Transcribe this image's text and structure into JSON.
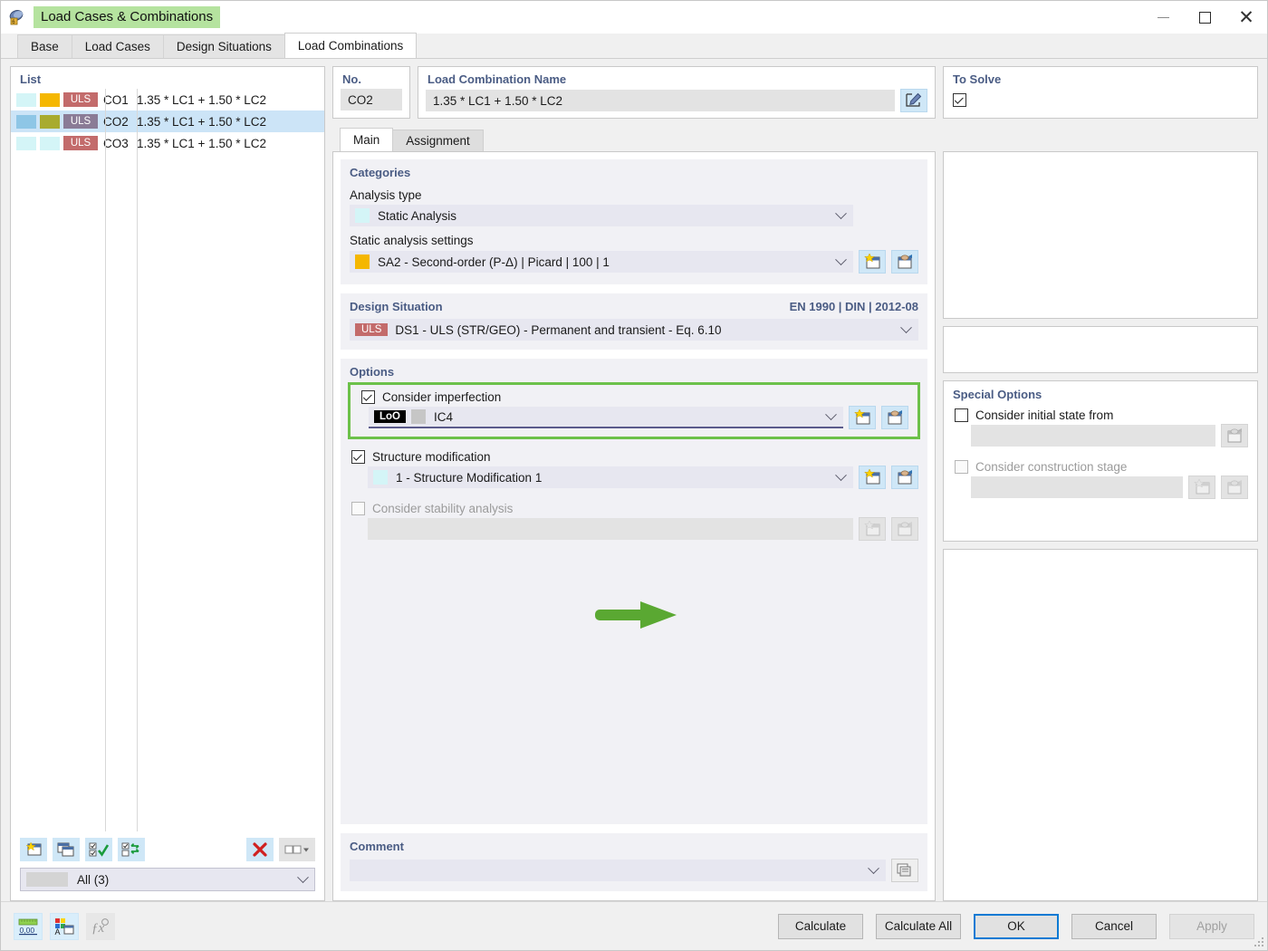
{
  "window": {
    "title": "Load Cases & Combinations",
    "icon": "load-cases-icon",
    "minimize_label": "—",
    "maximize_label": "□",
    "close_label": "✕"
  },
  "tabs": [
    {
      "label": "Base",
      "active": false
    },
    {
      "label": "Load Cases",
      "active": false
    },
    {
      "label": "Design Situations",
      "active": false
    },
    {
      "label": "Load Combinations",
      "active": true
    }
  ],
  "list_panel": {
    "title": "List",
    "rows": [
      {
        "sw1": "#d4f5f7",
        "sw2": "#f5b700",
        "badge": "ULS",
        "badge_bg": "#c36b6b",
        "id": "CO1",
        "expr": "1.35 * LC1 + 1.50 * LC2",
        "selected": false
      },
      {
        "sw1": "#8ec6e6",
        "sw2": "#a8ab2e",
        "badge": "ULS",
        "badge_bg": "#8a7b96",
        "id": "CO2",
        "expr": "1.35 * LC1 + 1.50 * LC2",
        "selected": true
      },
      {
        "sw1": "#d4f5f7",
        "sw2": "#d4f5f7",
        "badge": "ULS",
        "badge_bg": "#c36b6b",
        "id": "CO3",
        "expr": "1.35 * LC1 + 1.50 * LC2",
        "selected": false
      }
    ],
    "toolbar": {
      "new_label": "new-item",
      "copy_label": "copy-item",
      "select_all_label": "select-all",
      "invert_label": "invert-selection",
      "delete_label": "delete",
      "view_label": "view-options"
    },
    "filter": {
      "value": "All (3)"
    }
  },
  "no_box": {
    "title": "No.",
    "value": "CO2"
  },
  "name_box": {
    "title": "Load Combination Name",
    "value": "1.35 * LC1 + 1.50 * LC2",
    "edit_icon": "edit-pencil-icon"
  },
  "to_solve": {
    "title": "To Solve",
    "checked": true
  },
  "inner_tabs": [
    {
      "label": "Main",
      "active": true
    },
    {
      "label": "Assignment",
      "active": false
    }
  ],
  "categories": {
    "title": "Categories",
    "analysis_type": {
      "label": "Analysis type",
      "value": "Static Analysis",
      "swatch": "#d4f5f7"
    },
    "static_analysis_settings": {
      "label": "Static analysis settings",
      "value": "SA2 - Second-order (P-Δ) | Picard | 100 | 1",
      "swatch": "#f5b700",
      "new_icon": "new-item-icon",
      "edit_icon": "edit-item-icon"
    }
  },
  "design_situation": {
    "title": "Design Situation",
    "standard": "EN 1990 | DIN | 2012-08",
    "badge": "ULS",
    "value": "DS1 - ULS (STR/GEO) - Permanent and transient - Eq. 6.10"
  },
  "options": {
    "title": "Options",
    "consider_imperfection": {
      "label": "Consider imperfection",
      "checked": true,
      "highlighted": true,
      "badge": "LoO",
      "swatch": "#c6c6c6",
      "value": "IC4",
      "new_icon": "new-item-icon",
      "edit_icon": "edit-item-icon"
    },
    "structure_modification": {
      "label": "Structure modification",
      "checked": true,
      "swatch": "#d4f5f7",
      "value": "1 - Structure Modification 1",
      "new_icon": "new-item-icon",
      "edit_icon": "edit-item-icon"
    },
    "consider_stability_analysis": {
      "label": "Consider stability analysis",
      "checked": false,
      "disabled": true,
      "value": "",
      "new_icon": "new-item-icon",
      "edit_icon": "edit-item-icon"
    }
  },
  "special_options": {
    "title": "Special Options",
    "consider_initial_state_from": {
      "label": "Consider initial state from",
      "checked": false,
      "disabled": false,
      "value": "",
      "edit_icon": "edit-item-icon"
    },
    "consider_construction_stage": {
      "label": "Consider construction stage",
      "checked": false,
      "disabled": true,
      "value": "",
      "new_icon": "new-item-icon",
      "edit_icon": "edit-item-icon"
    }
  },
  "comment": {
    "title": "Comment",
    "value": "",
    "copy_icon": "copy-icon"
  },
  "footer": {
    "icons": [
      {
        "name": "units-icon",
        "label": "0,00",
        "disabled": false
      },
      {
        "name": "display-properties-icon",
        "label": "",
        "disabled": false
      },
      {
        "name": "formula-icon",
        "label": "ƒx",
        "disabled": true
      }
    ],
    "buttons": [
      {
        "label": "Calculate",
        "style": "normal"
      },
      {
        "label": "Calculate All",
        "style": "normal"
      },
      {
        "label": "OK",
        "style": "primary"
      },
      {
        "label": "Cancel",
        "style": "normal"
      },
      {
        "label": "Apply",
        "style": "disabled"
      }
    ]
  },
  "annotation": {
    "arrow_color": "#5aa832",
    "highlight_color": "#6cc14a"
  }
}
